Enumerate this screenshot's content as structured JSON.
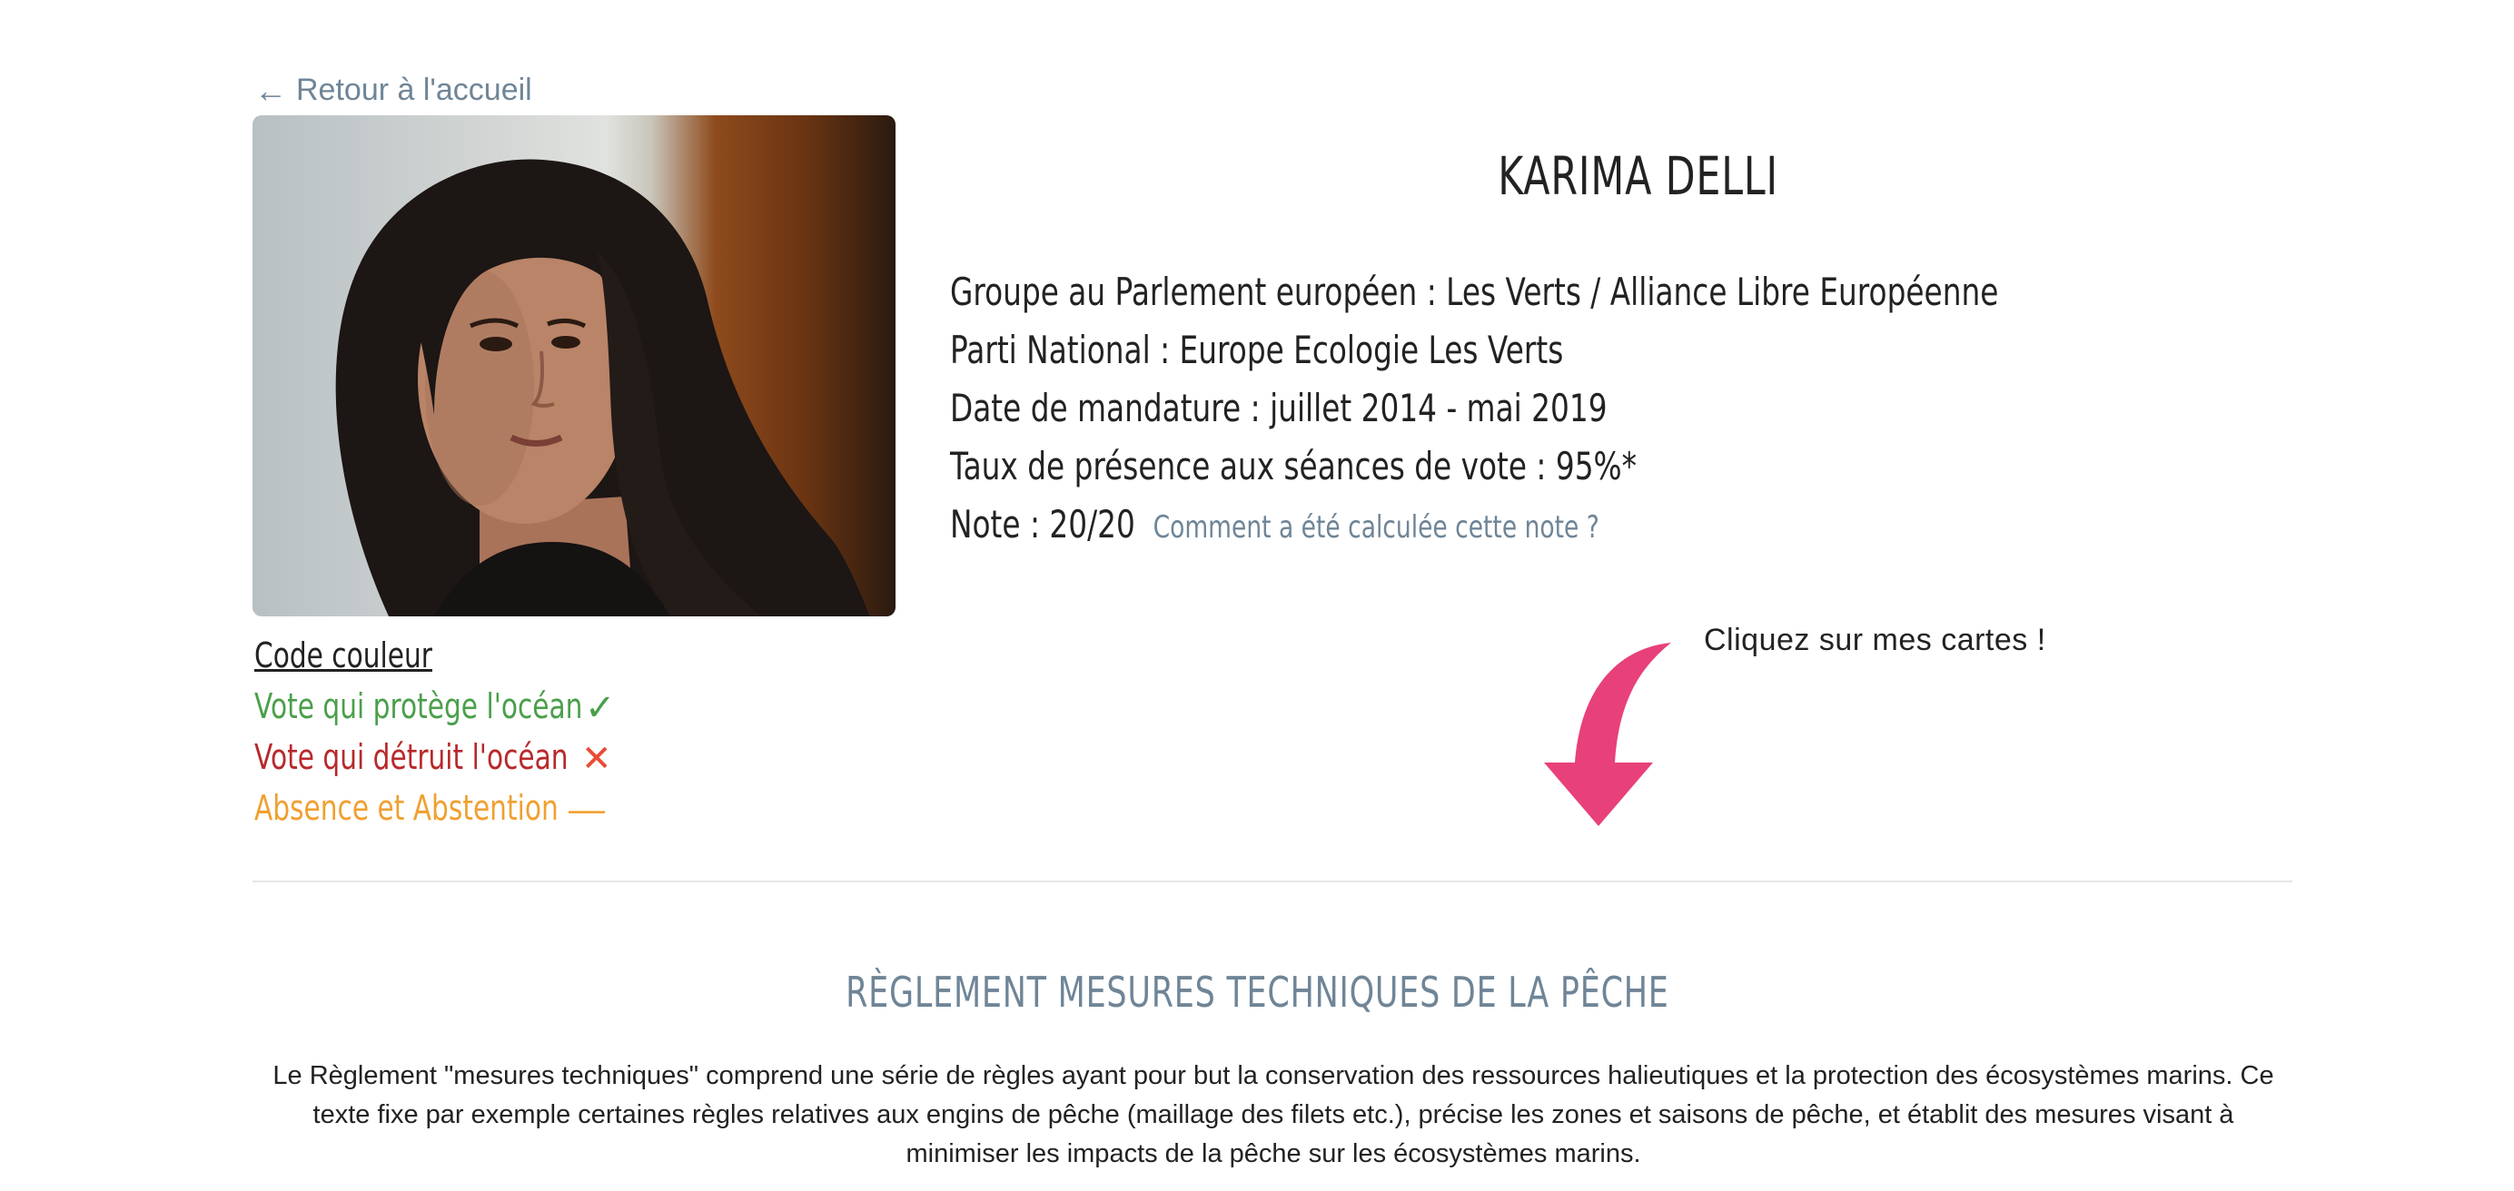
{
  "nav": {
    "back_arrow": "←",
    "back_label": "Retour à l'accueil"
  },
  "profile": {
    "name": "KARIMA DELLI",
    "group": "Groupe au Parlement européen : Les Verts / Alliance Libre Européenne",
    "party": "Parti National : Europe Ecologie Les Verts",
    "mandate": "Date de mandature : juillet 2014 - mai 2019",
    "attendance": "Taux de présence aux séances de vote : 95%*",
    "note": "Note : 20/20",
    "note_link": "Comment a été calculée cette note ?"
  },
  "legend": {
    "title": "Code couleur",
    "items": [
      {
        "label": "Vote qui protège l'océan",
        "symbol": "✓",
        "color": "#4a9f4a",
        "icon": "checkmark-icon"
      },
      {
        "label": "Vote qui détruit l'océan",
        "symbol": "✕",
        "color": "#b8282b",
        "icon": "cross-icon"
      },
      {
        "label": "Absence et Abstention",
        "symbol": "—",
        "color": "#f0a030",
        "icon": "dash-icon"
      }
    ]
  },
  "hint": {
    "text": "Cliquez sur mes cartes !",
    "arrow_color": "#e8407a"
  },
  "section": {
    "title": "RÈGLEMENT MESURES TECHNIQUES DE LA PÊCHE",
    "text": "Le Règlement \"mesures techniques\" comprend une série de règles ayant pour but la conservation des ressources halieutiques et la protection des écosystèmes marins. Ce texte fixe par exemple certaines règles relatives aux engins de pêche (maillage des filets etc.), précise les zones et saisons de pêche, et établit des mesures visant à minimiser les impacts de la pêche sur les écosystèmes marins."
  },
  "colors": {
    "link": "#6f8597",
    "text": "#222222",
    "divider": "#e6e6e6"
  }
}
